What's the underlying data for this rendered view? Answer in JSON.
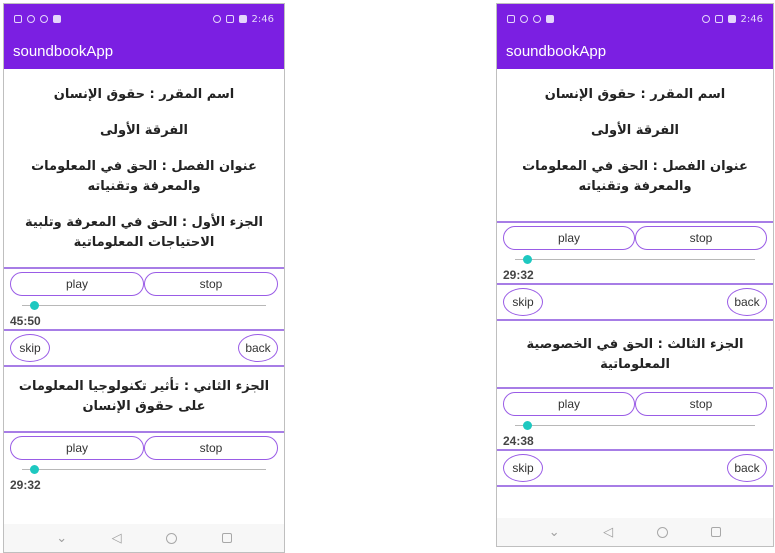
{
  "left": {
    "status_time": "2:46",
    "app_title": "soundbookApp",
    "texts": {
      "course": "اسم المقرر : حقوق الإنسان",
      "division": "الفرقة الأولى",
      "chapter": "عنوان الفصل : الحق في المعلومات والمعرفة وتقنياته",
      "part1": "الجزء الأول : الحق في المعرفة وتلبية الاحتياجات المعلوماتية",
      "part2": "الجزء الثاني : تأثير تكنولوجيا المعلومات على حقوق الإنسان"
    },
    "players": [
      {
        "play": "play",
        "stop": "stop",
        "time": "45:50",
        "skip": "skip",
        "back": "back",
        "progress": 0.05
      },
      {
        "play": "play",
        "stop": "stop",
        "time": "29:32",
        "progress": 0.05
      }
    ]
  },
  "right": {
    "status_time": "2:46",
    "app_title": "soundbookApp",
    "texts": {
      "course": "اسم المقرر : حقوق الإنسان",
      "division": "الفرقة الأولى",
      "chapter": "عنوان الفصل : الحق في المعلومات والمعرفة وتقنياته",
      "part3": "الجزء الثالث : الحق في الخصوصية المعلوماتية"
    },
    "players": [
      {
        "play": "play",
        "stop": "stop",
        "time": "29:32",
        "skip": "skip",
        "back": "back",
        "progress": 0.05
      },
      {
        "play": "play",
        "stop": "stop",
        "time": "24:38",
        "skip": "skip",
        "back": "back",
        "progress": 0.05
      }
    ]
  },
  "nav_icons": [
    "chevron-down-icon",
    "back-triangle-icon",
    "home-circle-icon",
    "recents-square-icon"
  ],
  "colors": {
    "primary": "#7b1fe2",
    "accent": "#1ec8c0",
    "button_border": "#9a5ce6",
    "divider": "#a77de6"
  }
}
